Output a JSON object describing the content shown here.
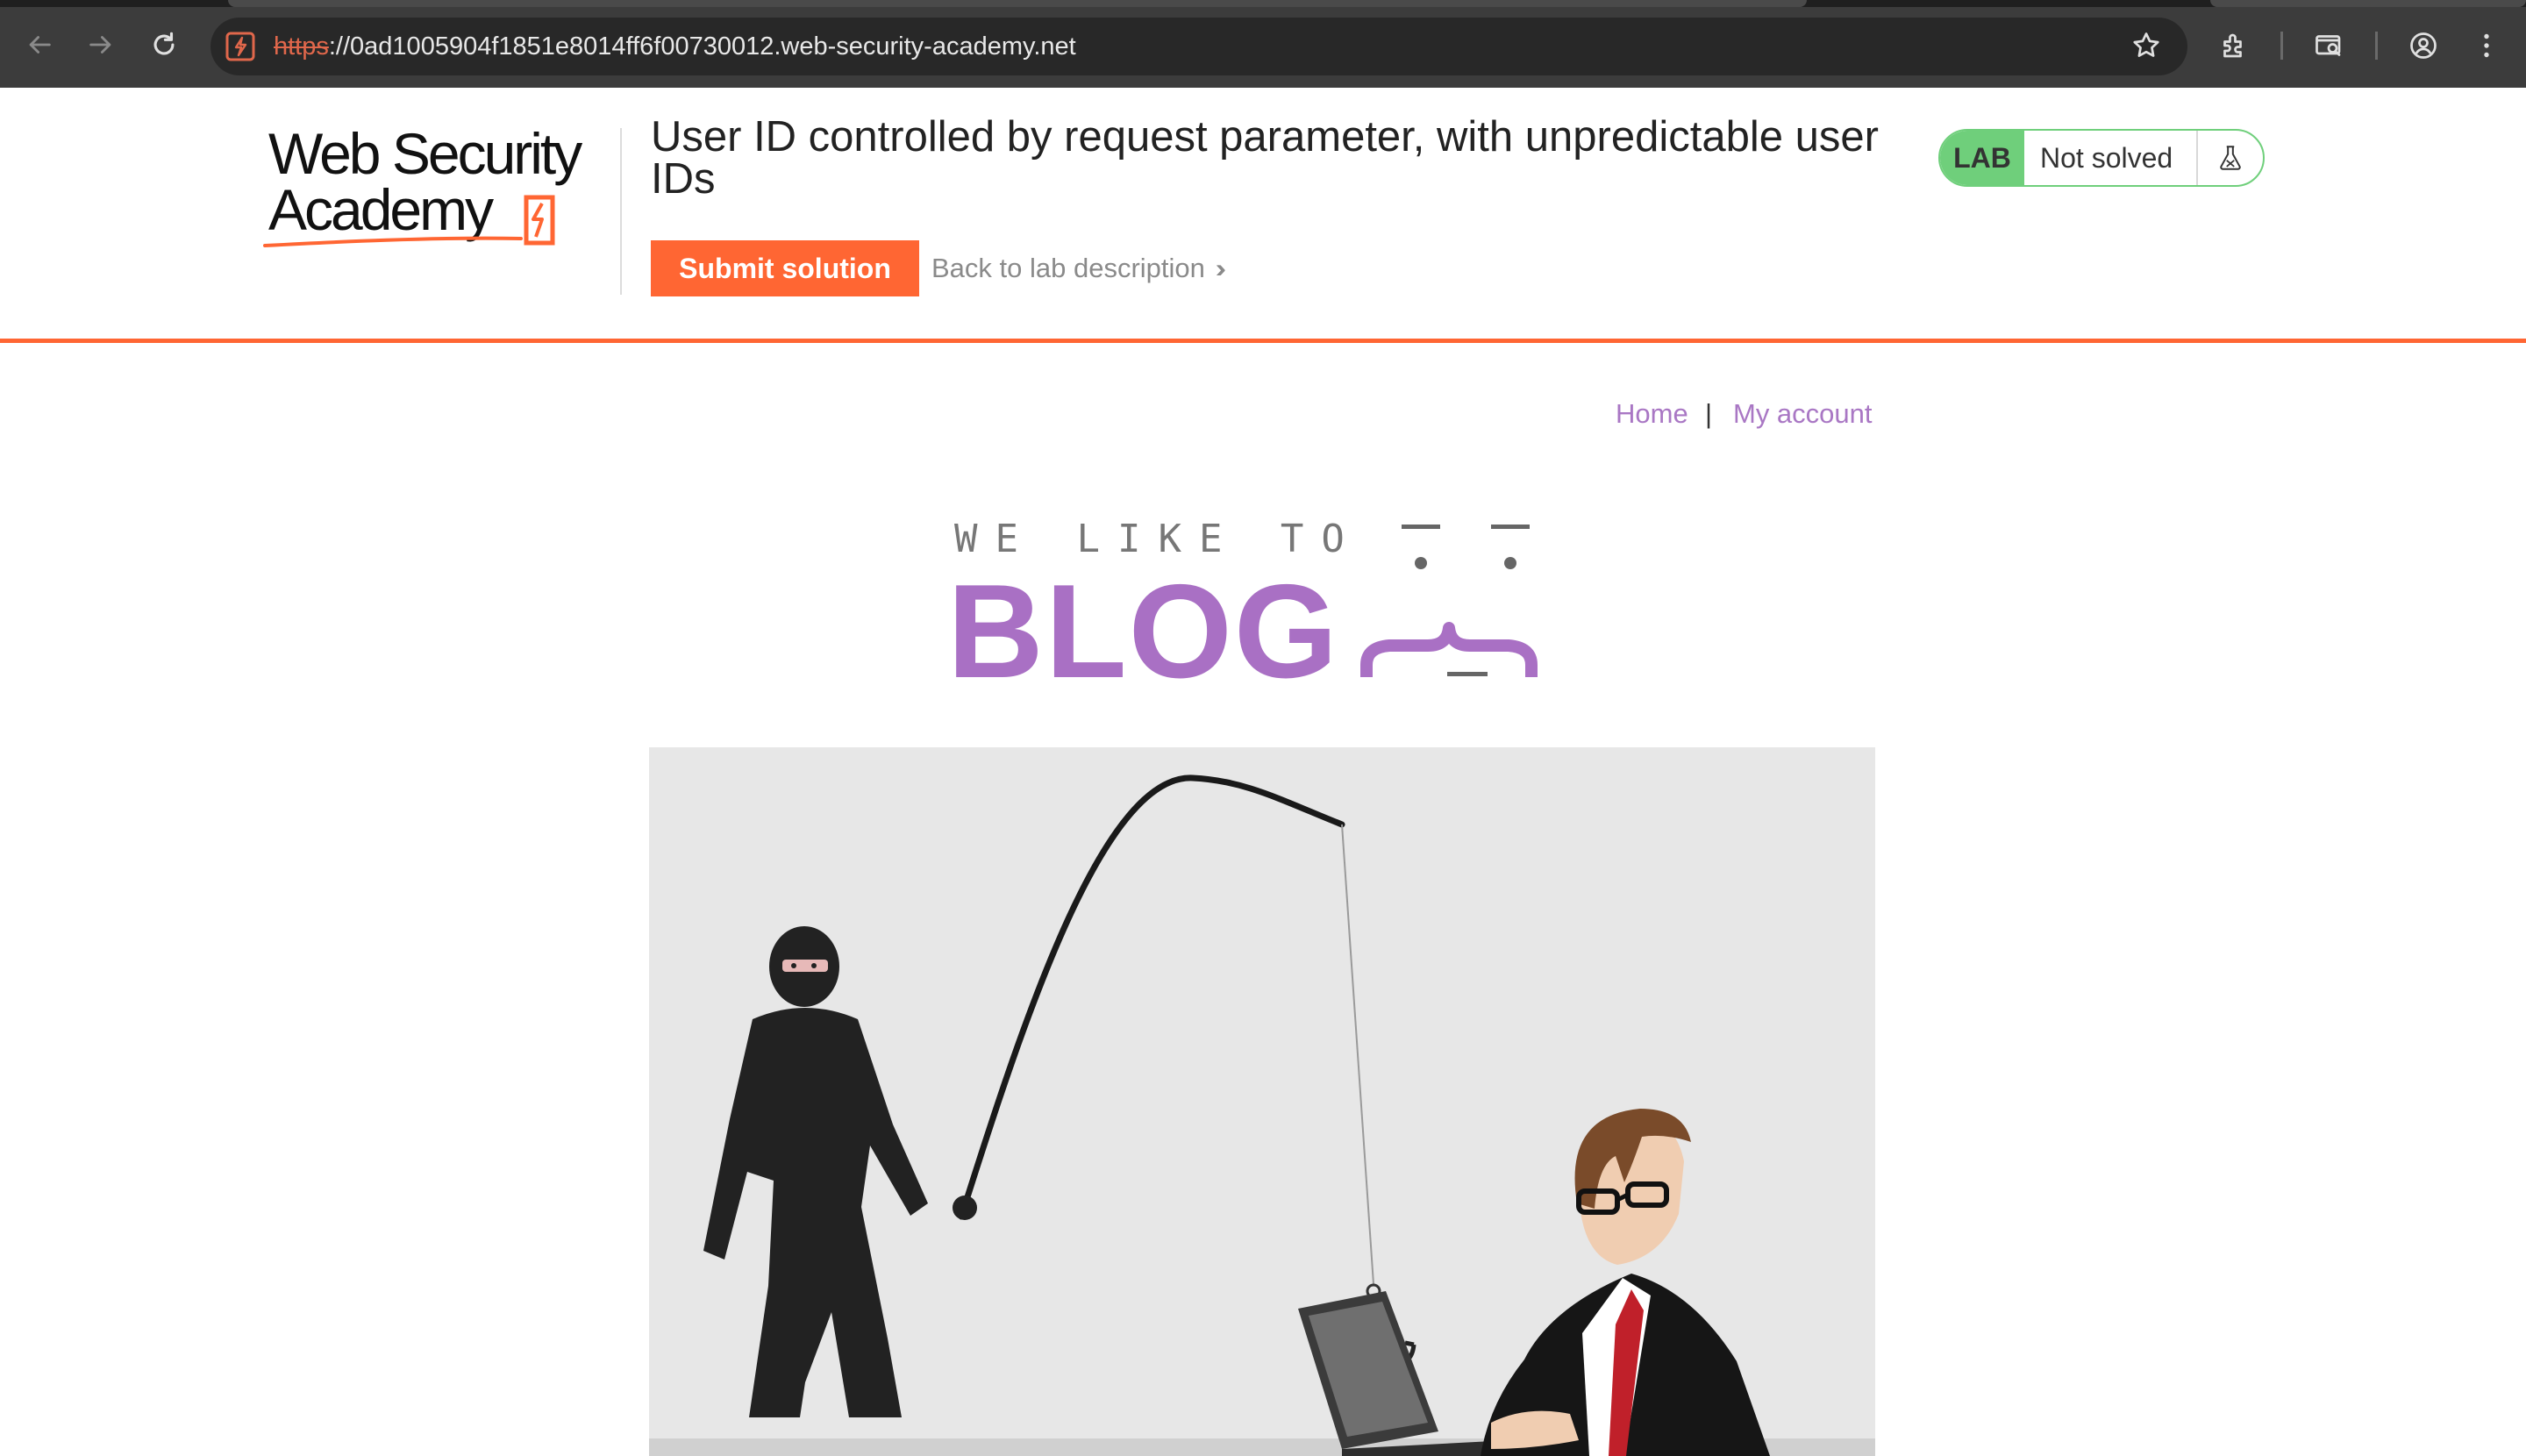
{
  "browser": {
    "url_scheme": "https",
    "url_rest": "://0ad1005904f1851e8014ff6f00730012.web-security-academy.net",
    "icons": [
      "back-arrow-icon",
      "forward-arrow-icon",
      "reload-icon",
      "site-icon",
      "bookmark-star-icon",
      "extensions-icon",
      "tab-search-icon",
      "profile-icon",
      "menu-icon"
    ]
  },
  "lab": {
    "logo_line1": "Web Security",
    "logo_line2": "Academy",
    "title": "User ID controlled by request parameter, with unpredictable user IDs",
    "submit_label": "Submit solution",
    "back_label": "Back to lab description",
    "badge": "LAB",
    "status": "Not solved",
    "accent_color": "#ff6633",
    "status_color": "#6fcf7b"
  },
  "blog": {
    "nav": {
      "home": "Home",
      "separator": "|",
      "account": "My account"
    },
    "tagline": "WE LIKE TO",
    "title": "BLOG",
    "accent_color": "#a970c4",
    "hero_image": "phishing-illustration"
  }
}
